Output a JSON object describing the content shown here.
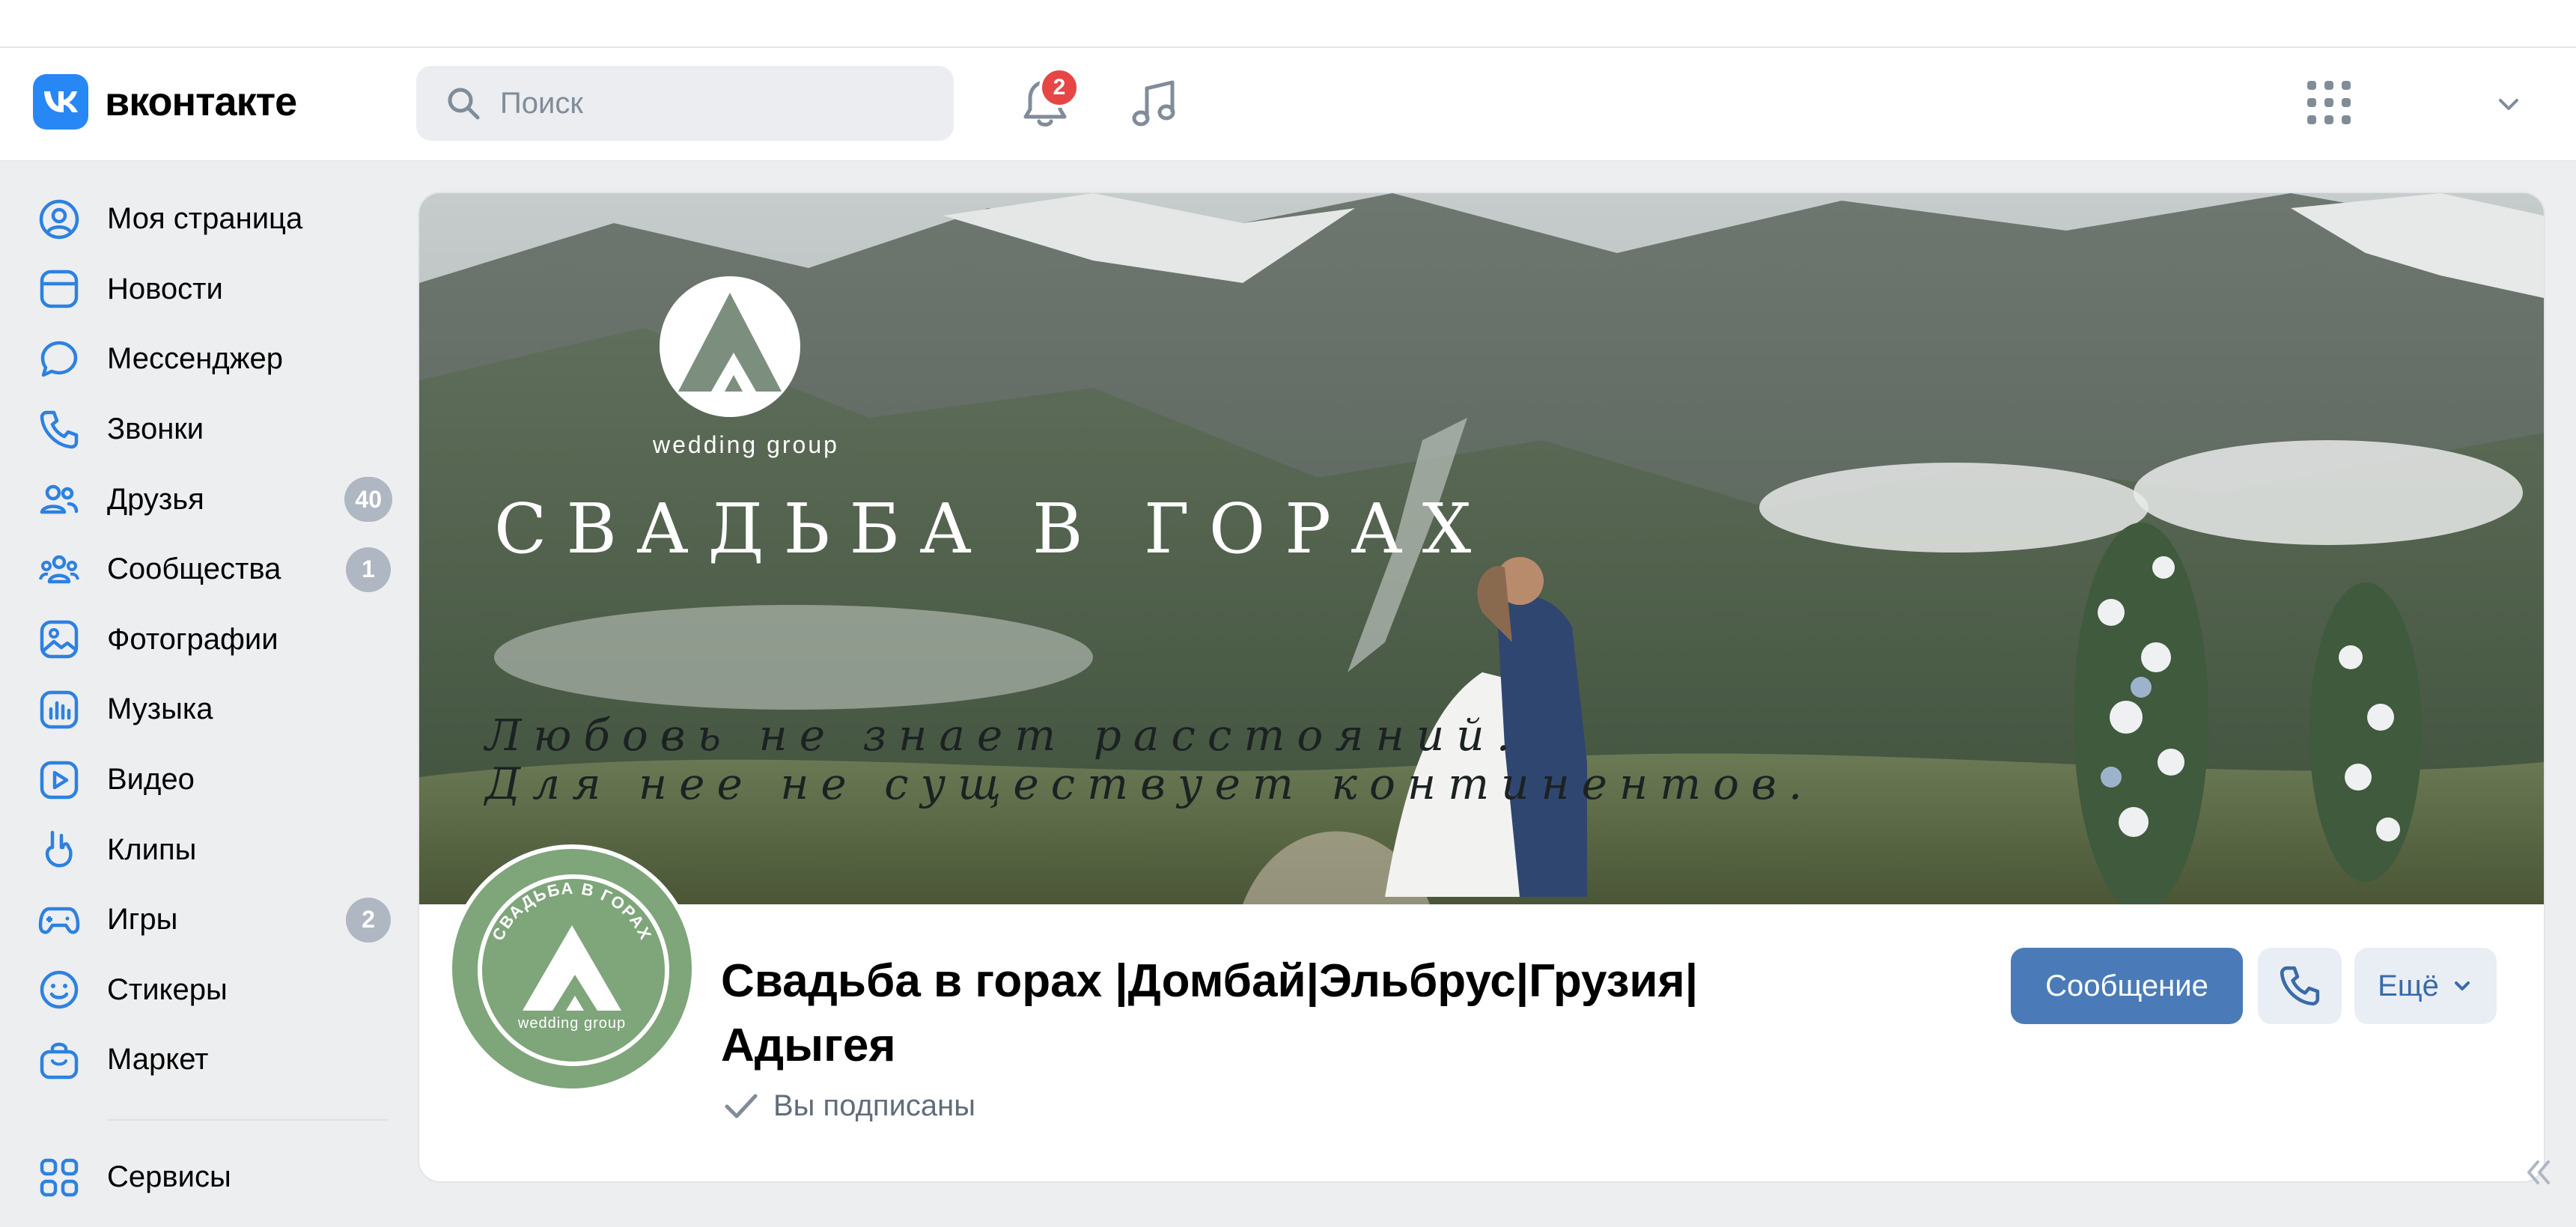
{
  "header": {
    "logo_text": "вконтакте",
    "search_placeholder": "Поиск",
    "notifications_count": "2"
  },
  "sidebar": {
    "items": [
      {
        "label": "Моя страница",
        "icon": "user-circle-icon"
      },
      {
        "label": "Новости",
        "icon": "news-icon"
      },
      {
        "label": "Мессенджер",
        "icon": "message-icon"
      },
      {
        "label": "Звонки",
        "icon": "phone-icon"
      },
      {
        "label": "Друзья",
        "icon": "friends-icon",
        "badge": "40"
      },
      {
        "label": "Сообщества",
        "icon": "communities-icon",
        "badge": "1"
      },
      {
        "label": "Фотографии",
        "icon": "photos-icon"
      },
      {
        "label": "Музыка",
        "icon": "music-icon"
      },
      {
        "label": "Видео",
        "icon": "video-icon"
      },
      {
        "label": "Клипы",
        "icon": "clips-icon"
      },
      {
        "label": "Игры",
        "icon": "games-icon",
        "badge": "2"
      },
      {
        "label": "Стикеры",
        "icon": "stickers-icon"
      },
      {
        "label": "Маркет",
        "icon": "market-icon"
      }
    ],
    "services_label": "Сервисы"
  },
  "cover": {
    "brand": "wedding group",
    "title": "СВАДЬБА В ГОРАХ",
    "script_line1": "Любовь не знает расстояний.",
    "script_line2": "Для нее не существует континентов."
  },
  "avatar": {
    "ring_text": "СВАДЬБА В ГОРАХ",
    "brand": "wedding group"
  },
  "group": {
    "name": "Свадьба в горах |Домбай|Эльбрус|Грузия| Адыгея",
    "subscription_status": "Вы подписаны"
  },
  "actions": {
    "message_label": "Сообщение",
    "more_label": "Ещё"
  },
  "colors": {
    "accent": "#4a7bb8",
    "vk_blue": "#2787f5",
    "badge_red": "#e64646",
    "avatar_green": "#7fa57b"
  }
}
